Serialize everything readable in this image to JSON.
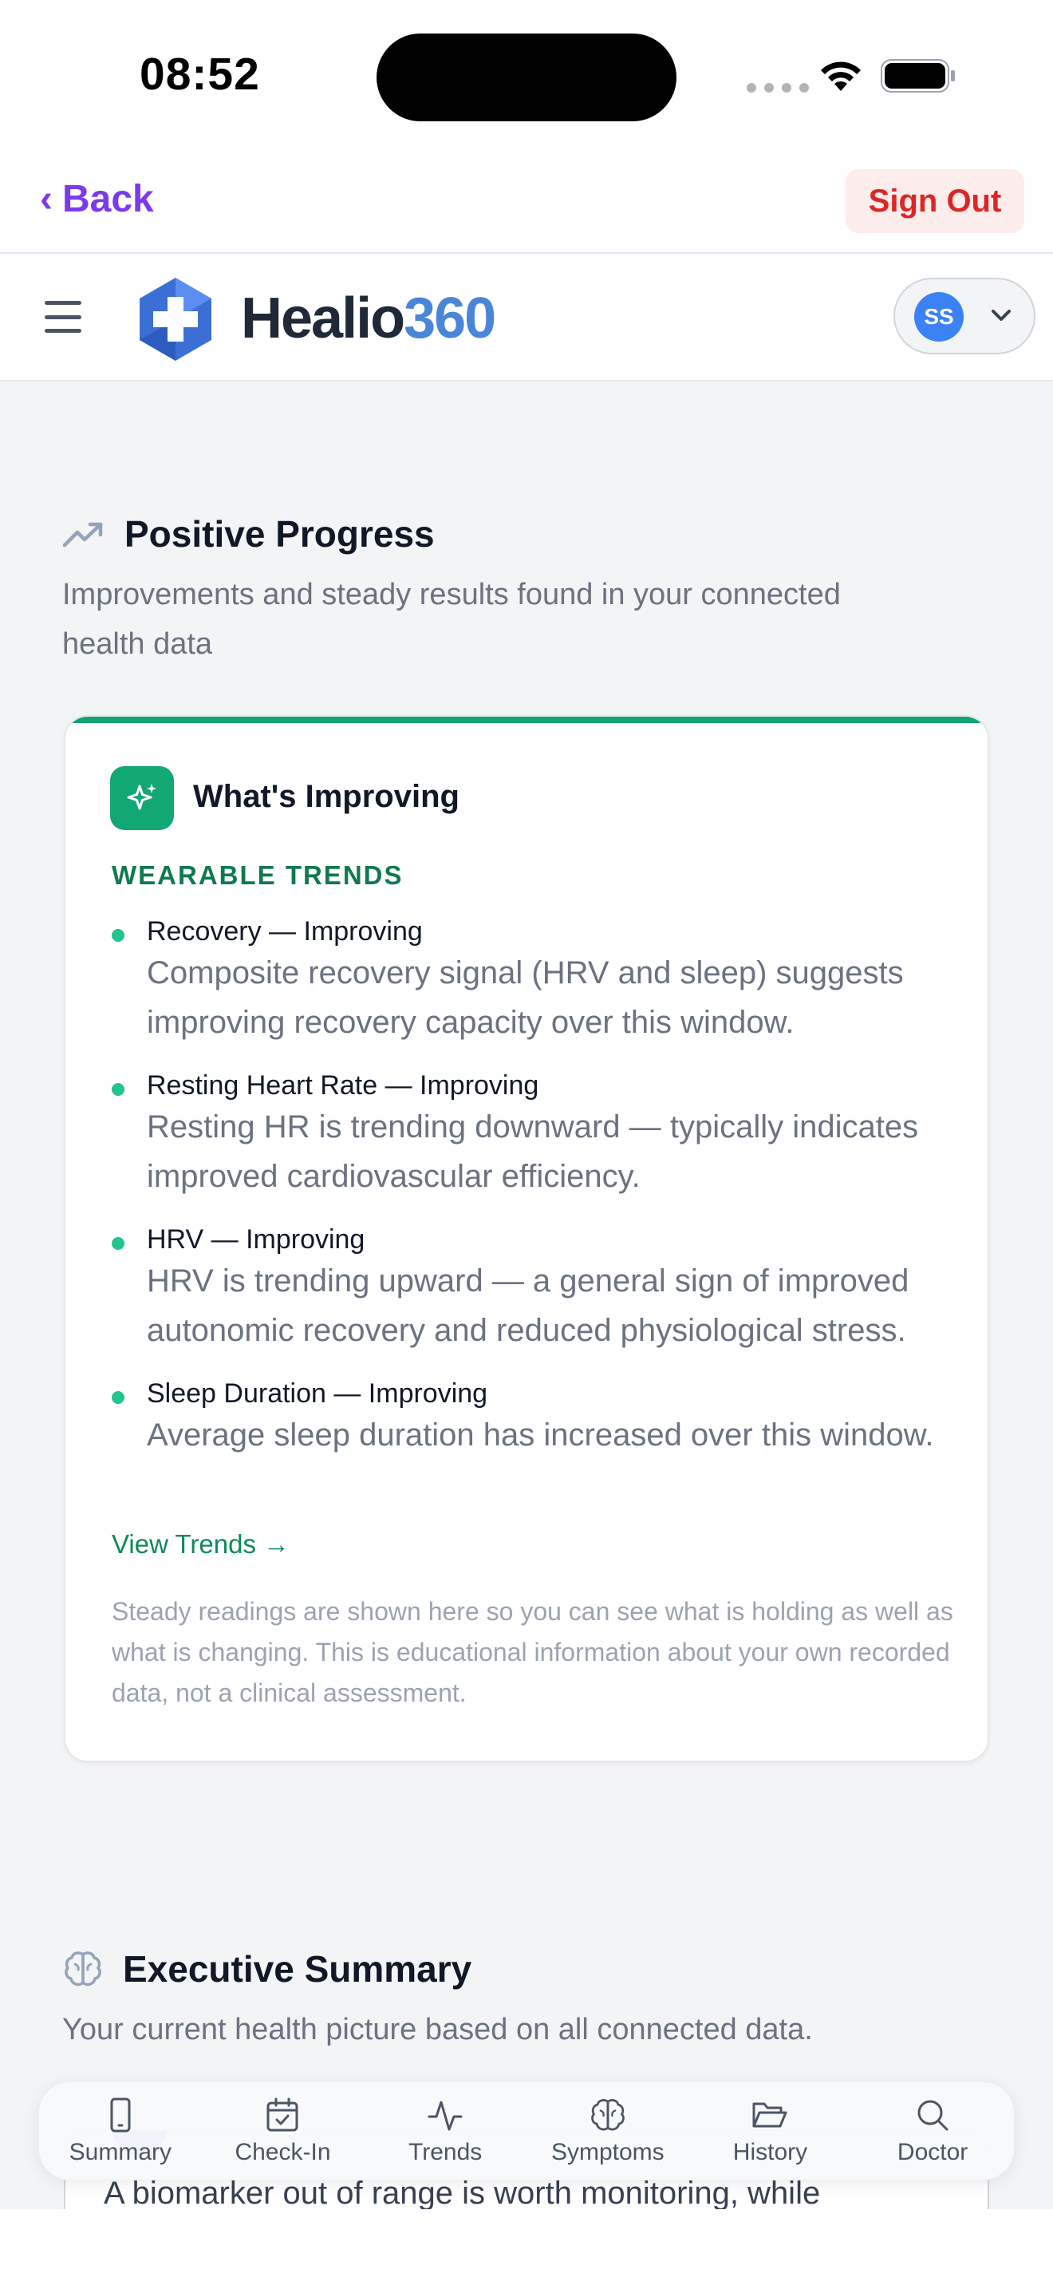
{
  "status_bar": {
    "time": "08:52"
  },
  "nav": {
    "back_label": "Back",
    "back_chevron": "‹",
    "signout_label": "Sign Out"
  },
  "header": {
    "logo_part1": "Healio",
    "logo_part2": "360",
    "avatar_initials": "SS"
  },
  "positive_progress": {
    "title": "Positive Progress",
    "subtitle": "Improvements and steady results found in your connected health data",
    "card": {
      "title": "What's Improving",
      "overline": "WEARABLE TRENDS",
      "items": [
        {
          "title": "Recovery — Improving",
          "desc": "Composite recovery signal (HRV and sleep) suggests improving recovery capacity over this window."
        },
        {
          "title": "Resting Heart Rate — Improving",
          "desc": "Resting HR is trending downward — typically indicates improved cardiovascular efficiency."
        },
        {
          "title": "HRV — Improving",
          "desc": "HRV is trending upward — a general sign of improved autonomic recovery and reduced physiological stress."
        },
        {
          "title": "Sleep Duration — Improving",
          "desc": "Average sleep duration has increased over this window."
        }
      ],
      "link_label": "View Trends →",
      "note": "Steady readings are shown here so you can see what is holding as well as what is changing. This is educational information about your own recorded data, not a clinical assessment."
    }
  },
  "executive_summary": {
    "title": "Executive Summary",
    "subtitle": "Your current health picture based on all connected data.",
    "teaser": "A biomarker out of range is worth monitoring, while"
  },
  "tabs": [
    {
      "label": "Summary",
      "icon": "phone-icon"
    },
    {
      "label": "Check-In",
      "icon": "calendar-check-icon"
    },
    {
      "label": "Trends",
      "icon": "activity-icon"
    },
    {
      "label": "Symptoms",
      "icon": "brain-icon"
    },
    {
      "label": "History",
      "icon": "folder-open-icon"
    },
    {
      "label": "Doctor",
      "icon": "search-icon"
    }
  ],
  "colors": {
    "accent": "#7c3aed",
    "positive": "#10a56f",
    "brand_blue": "#4a86d8",
    "danger": "#dc2626"
  }
}
